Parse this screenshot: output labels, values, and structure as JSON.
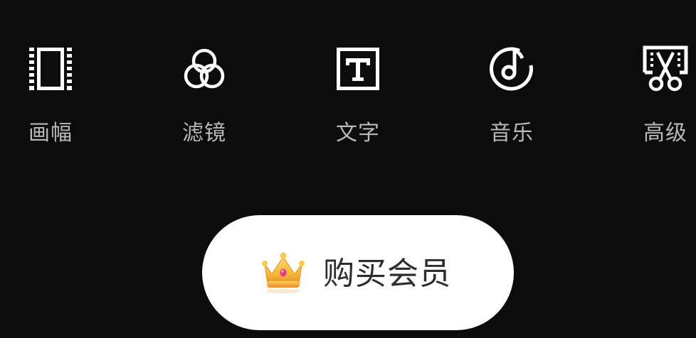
{
  "toolbar": {
    "items": [
      {
        "label": "画幅",
        "icon": "aspect-ratio-icon"
      },
      {
        "label": "滤镜",
        "icon": "filter-icon"
      },
      {
        "label": "文字",
        "icon": "text-icon"
      },
      {
        "label": "音乐",
        "icon": "music-icon"
      },
      {
        "label": "高级",
        "icon": "advanced-edit-icon"
      }
    ]
  },
  "vip": {
    "label": "购买会员",
    "icon": "crown-icon"
  },
  "colors": {
    "background": "#0c0c0c",
    "icon": "#ffffff",
    "label": "#b9b9b9",
    "button_bg": "#ffffff",
    "button_text": "#2e2e2e",
    "crown_gold": "#f6b93b"
  }
}
